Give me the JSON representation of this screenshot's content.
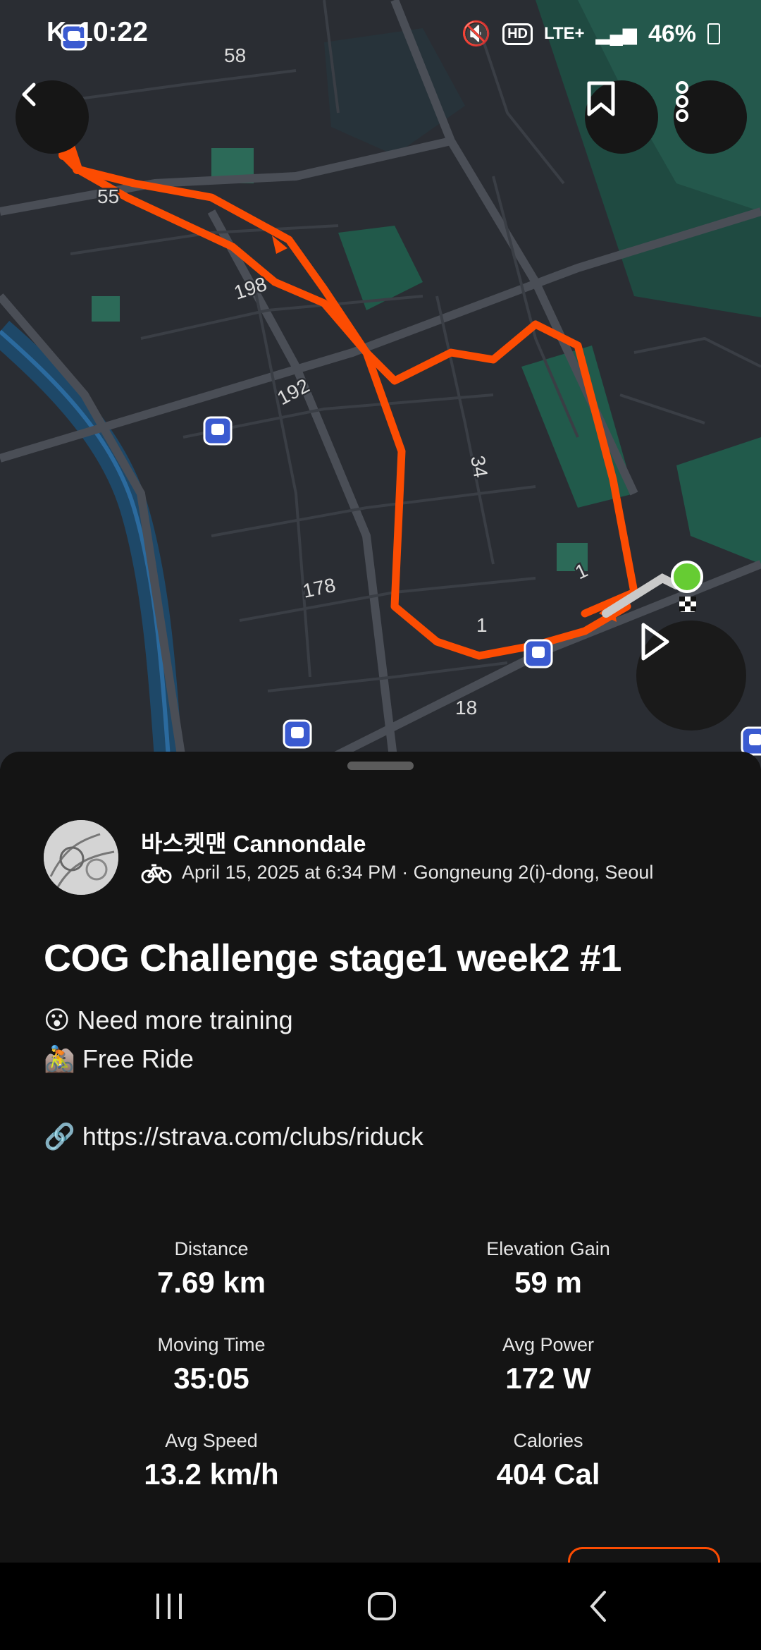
{
  "status_bar": {
    "carrier": "K",
    "time": "10:22",
    "network": "LTE+",
    "battery": "46%"
  },
  "map": {
    "road_labels": [
      "58",
      "55",
      "198",
      "192",
      "34",
      "178",
      "1",
      "1",
      "18"
    ],
    "route_color": "#fc4c02",
    "start_marker_color": "#66cc33"
  },
  "activity": {
    "athlete_name": "바스켓맨 Cannondale",
    "date_location": "April 15, 2025 at 6:34 PM · Gongneung 2(i)-dong, Seoul",
    "title": "COG Challenge stage1 week2 #1",
    "description": [
      {
        "emoji": "😮",
        "text": "Need more training"
      },
      {
        "emoji": "🚵",
        "text": "Free Ride"
      },
      {
        "emoji": "🔗",
        "text": "https://strava.com/clubs/riduck"
      }
    ]
  },
  "stats": [
    {
      "label": "Distance",
      "value": "7.69 km"
    },
    {
      "label": "Elevation Gain",
      "value": "59 m"
    },
    {
      "label": "Moving Time",
      "value": "35:05"
    },
    {
      "label": "Avg Power",
      "value": "172 W"
    },
    {
      "label": "Avg Speed",
      "value": "13.2 km/h"
    },
    {
      "label": "Calories",
      "value": "404 Cal"
    }
  ]
}
